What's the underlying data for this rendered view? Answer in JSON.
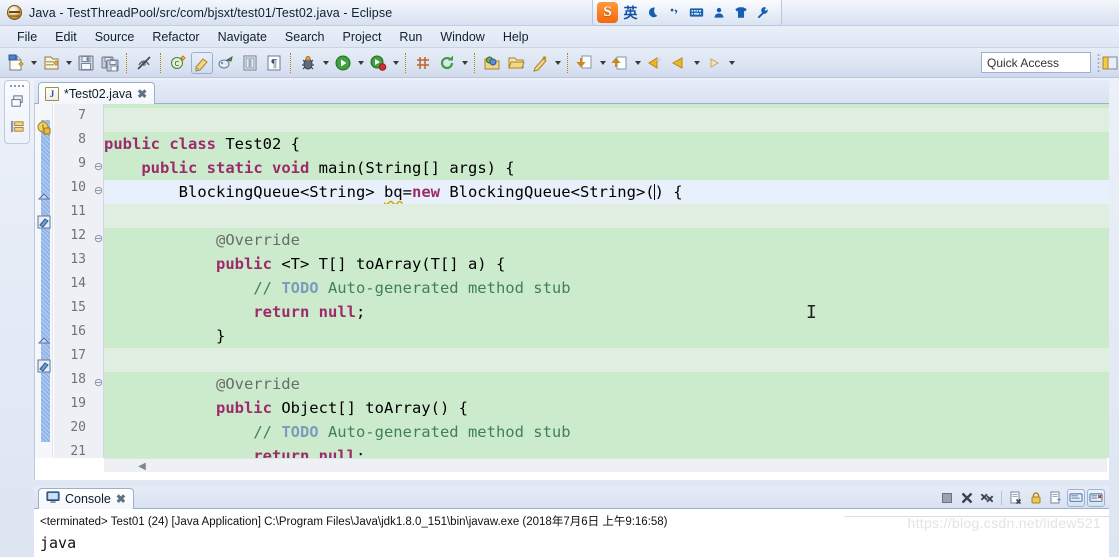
{
  "window": {
    "title": "Java - TestThreadPool/src/com/bjsxt/test01/Test02.java - Eclipse",
    "logo_icon": "eclipse-logo-icon"
  },
  "ime": {
    "logo_label": "S",
    "items": [
      {
        "name": "ime-language-mode",
        "glyph": "英"
      },
      {
        "name": "ime-moon-icon",
        "glyph": "☾"
      },
      {
        "name": "ime-punctuation-icon",
        "glyph": "’‚"
      },
      {
        "name": "ime-keyboard-icon",
        "glyph": "⌨"
      },
      {
        "name": "ime-user-icon",
        "glyph": "⚬"
      },
      {
        "name": "ime-skin-icon",
        "glyph": "T"
      },
      {
        "name": "ime-settings-icon",
        "glyph": "⚙"
      }
    ]
  },
  "menubar": {
    "items": [
      "File",
      "Edit",
      "Source",
      "Refactor",
      "Navigate",
      "Search",
      "Project",
      "Run",
      "Window",
      "Help"
    ]
  },
  "toolbar": {
    "quick_access_placeholder": "Quick Access",
    "quick_access_value": "",
    "buttons": [
      {
        "name": "new-wizard-button",
        "icon": "new-file-icon",
        "dropdown": true
      },
      {
        "name": "new-java-package-button",
        "icon": "new-package-icon",
        "dropdown": true
      },
      {
        "name": "save-button",
        "icon": "save-icon",
        "dropdown": false
      },
      {
        "name": "save-all-button",
        "icon": "save-all-icon",
        "dropdown": false
      },
      {
        "name": "skip-all-breakpoints-button",
        "icon": "skip-breakpoints-icon",
        "dropdown": false
      },
      {
        "name": "new-java-class-button",
        "icon": "new-class-icon",
        "dropdown": false
      },
      {
        "name": "toggle-mark-occurrences-button",
        "icon": "highlight-pen-icon",
        "dropdown": false
      },
      {
        "name": "external-tools-button",
        "icon": "external-tools-icon",
        "dropdown": false
      },
      {
        "name": "open-task-button",
        "icon": "open-task-icon",
        "dropdown": false
      },
      {
        "name": "toggle-whitespace-button",
        "icon": "pilcrow-icon",
        "dropdown": false
      },
      {
        "name": "debug-button",
        "icon": "debug-bug-icon",
        "dropdown": true
      },
      {
        "name": "run-button",
        "icon": "run-play-icon",
        "dropdown": true
      },
      {
        "name": "coverage-button",
        "icon": "coverage-icon",
        "dropdown": true
      },
      {
        "name": "new-java-project-button",
        "icon": "grid-icon",
        "dropdown": false
      },
      {
        "name": "refresh-button",
        "icon": "refresh-icon",
        "dropdown": true
      },
      {
        "name": "open-type-button",
        "icon": "open-type-icon",
        "dropdown": false
      },
      {
        "name": "open-task-folder-button",
        "icon": "folder-open-icon",
        "dropdown": false
      },
      {
        "name": "search-button",
        "icon": "search-pen-icon",
        "dropdown": true
      },
      {
        "name": "next-annotation-button",
        "icon": "next-annotation-icon",
        "dropdown": true
      },
      {
        "name": "previous-annotation-button",
        "icon": "previous-annotation-icon",
        "dropdown": true
      },
      {
        "name": "back-history-button",
        "icon": "back-arrow-star-icon",
        "dropdown": false
      },
      {
        "name": "back-button",
        "icon": "back-arrow-icon",
        "dropdown": true
      },
      {
        "name": "forward-button",
        "icon": "forward-arrow-icon",
        "dropdown": true
      }
    ]
  },
  "left_stack": {
    "items": [
      {
        "name": "restore-package-explorer",
        "icon": "restore-icon"
      },
      {
        "name": "minimized-package-explorer",
        "icon": "package-explorer-icon"
      }
    ]
  },
  "editor": {
    "tab": {
      "label": "*Test02.java",
      "dirty": true,
      "close_label": "✖",
      "file_icon": "java-file-icon"
    },
    "first_line_number": 7,
    "cursor_line": 10,
    "lines": [
      {
        "n": 7,
        "fold": "",
        "marker": "",
        "indent": 0,
        "segments": []
      },
      {
        "n": 8,
        "fold": "",
        "marker": "",
        "indent": 0,
        "segments": [
          {
            "t": "public",
            "c": "kw"
          },
          {
            "t": " ",
            "c": ""
          },
          {
            "t": "class",
            "c": "kw"
          },
          {
            "t": " Test02 {",
            "c": ""
          }
        ]
      },
      {
        "n": 9,
        "fold": "-",
        "marker": "",
        "indent": 1,
        "segments": [
          {
            "t": "public",
            "c": "kw"
          },
          {
            "t": " ",
            "c": ""
          },
          {
            "t": "static",
            "c": "kw"
          },
          {
            "t": " ",
            "c": ""
          },
          {
            "t": "void",
            "c": "kw"
          },
          {
            "t": " main(String[] args) {",
            "c": ""
          }
        ]
      },
      {
        "n": 10,
        "fold": "-",
        "marker": "warning",
        "indent": 2,
        "segments": [
          {
            "t": "BlockingQueue<String> ",
            "c": ""
          },
          {
            "t": "bq",
            "c": "warnspell"
          },
          {
            "t": "=",
            "c": ""
          },
          {
            "t": "new",
            "c": "kw"
          },
          {
            "t": " BlockingQueue<String>(",
            "c": ""
          },
          {
            "t": "|CARET|",
            "c": "caret"
          },
          {
            "t": ") {",
            "c": ""
          }
        ]
      },
      {
        "n": 11,
        "fold": "",
        "marker": "",
        "indent": 0,
        "segments": []
      },
      {
        "n": 12,
        "fold": "-",
        "marker": "",
        "indent": 3,
        "segments": [
          {
            "t": "@Override",
            "c": "ann"
          }
        ]
      },
      {
        "n": 13,
        "fold": "",
        "marker": "override",
        "indent": 3,
        "segments": [
          {
            "t": "public",
            "c": "kw"
          },
          {
            "t": " <T> T[] toArray(T[] a) {",
            "c": ""
          }
        ]
      },
      {
        "n": 14,
        "fold": "",
        "marker": "",
        "indent": 4,
        "segments": [
          {
            "t": "// ",
            "c": "cmt"
          },
          {
            "t": "TODO",
            "c": "todo"
          },
          {
            "t": " Auto-generated method stub",
            "c": "cmt"
          }
        ]
      },
      {
        "n": 15,
        "fold": "",
        "marker": "",
        "indent": 4,
        "segments": [
          {
            "t": "return",
            "c": "kw"
          },
          {
            "t": " ",
            "c": ""
          },
          {
            "t": "null",
            "c": "kw"
          },
          {
            "t": ";",
            "c": ""
          }
        ]
      },
      {
        "n": 16,
        "fold": "",
        "marker": "",
        "indent": 3,
        "segments": [
          {
            "t": "}",
            "c": ""
          }
        ]
      },
      {
        "n": 17,
        "fold": "",
        "marker": "",
        "indent": 0,
        "segments": []
      },
      {
        "n": 18,
        "fold": "-",
        "marker": "",
        "indent": 3,
        "segments": [
          {
            "t": "@Override",
            "c": "ann"
          }
        ]
      },
      {
        "n": 19,
        "fold": "",
        "marker": "override",
        "indent": 3,
        "segments": [
          {
            "t": "public",
            "c": "kw"
          },
          {
            "t": " Object[] toArray() {",
            "c": ""
          }
        ]
      },
      {
        "n": 20,
        "fold": "",
        "marker": "",
        "indent": 4,
        "segments": [
          {
            "t": "// ",
            "c": "cmt"
          },
          {
            "t": "TODO",
            "c": "todo"
          },
          {
            "t": " Auto-generated method stub",
            "c": "cmt"
          }
        ]
      },
      {
        "n": 21,
        "fold": "",
        "marker": "",
        "indent": 4,
        "segments": [
          {
            "t": "return",
            "c": "kw"
          },
          {
            "t": " ",
            "c": ""
          },
          {
            "t": "null",
            "c": "kw"
          },
          {
            "t": ";",
            "c": ""
          }
        ]
      }
    ],
    "mouse_cursor_glyph": "I"
  },
  "console": {
    "tab": {
      "label": "Console",
      "close_label": "✖",
      "icon": "console-icon"
    },
    "terminated_line": "<terminated> Test01 (24) [Java Application] C:\\Program Files\\Java\\jdk1.8.0_151\\bin\\javaw.exe (2018年7月6日 上午9:16:58)",
    "output_lines": [
      "java"
    ],
    "tools": [
      {
        "name": "terminate-button",
        "icon": "stop-square-icon",
        "boxed": false
      },
      {
        "name": "remove-launch-button",
        "icon": "remove-x-icon",
        "boxed": false
      },
      {
        "name": "remove-all-terminated-button",
        "icon": "remove-all-xx-icon",
        "boxed": false
      },
      {
        "name": "clear-console-button",
        "icon": "clear-console-icon",
        "boxed": false
      },
      {
        "name": "scroll-lock-button",
        "icon": "lock-icon",
        "boxed": false
      },
      {
        "name": "pin-console-button",
        "icon": "pin-console-icon",
        "boxed": false
      },
      {
        "name": "display-selected-console-button",
        "icon": "display-console-icon",
        "boxed": true
      },
      {
        "name": "open-console-button",
        "icon": "open-console-icon",
        "boxed": true
      }
    ]
  },
  "watermark": {
    "text": "https://blog.csdn.net/lidew521"
  },
  "colors": {
    "editor_background": "#ccebcc",
    "current_line": "#e8f0fb",
    "keyword": "#9c2a6d",
    "comment": "#3f7f5f",
    "todo": "#7c9cbd",
    "annotation": "#6b6b6b",
    "chrome": "#dae2f1",
    "accent": "#f4680c"
  }
}
